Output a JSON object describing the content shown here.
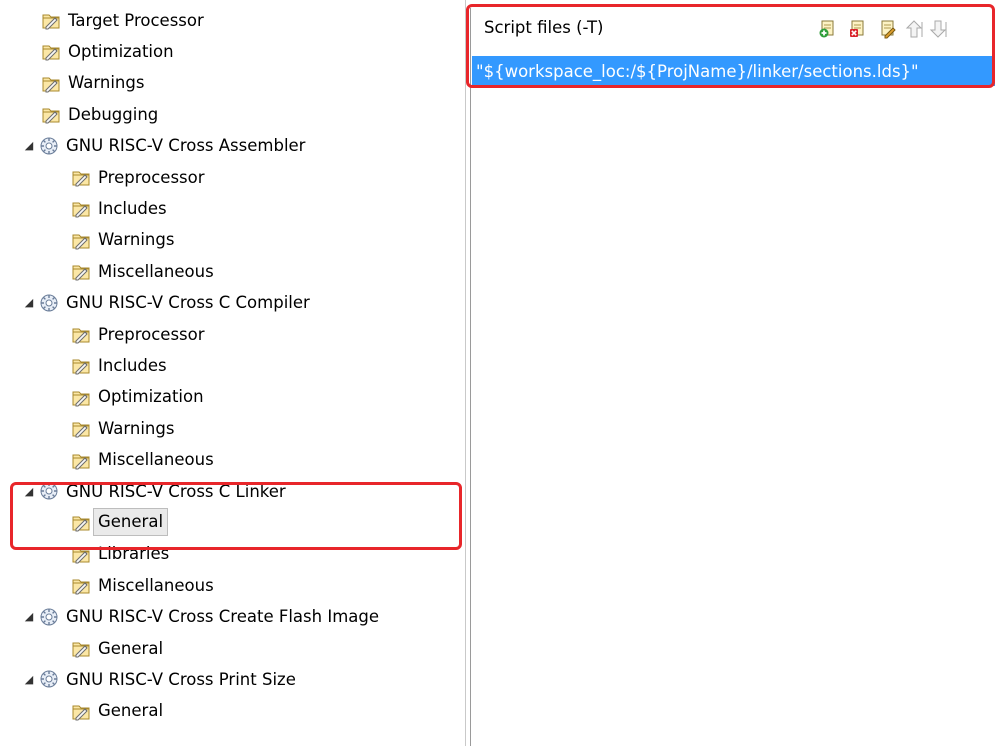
{
  "tree": {
    "items": [
      {
        "label": "Target Processor",
        "level": 1,
        "type": "option",
        "expanded": false,
        "selected": false
      },
      {
        "label": "Optimization",
        "level": 1,
        "type": "option",
        "expanded": false,
        "selected": false
      },
      {
        "label": "Warnings",
        "level": 1,
        "type": "option",
        "expanded": false,
        "selected": false
      },
      {
        "label": "Debugging",
        "level": 1,
        "type": "option",
        "expanded": false,
        "selected": false
      },
      {
        "label": "GNU RISC-V Cross Assembler",
        "level": 0,
        "type": "tool",
        "expanded": true,
        "selected": false
      },
      {
        "label": "Preprocessor",
        "level": 1,
        "type": "option",
        "expanded": false,
        "selected": false
      },
      {
        "label": "Includes",
        "level": 1,
        "type": "option",
        "expanded": false,
        "selected": false
      },
      {
        "label": "Warnings",
        "level": 1,
        "type": "option",
        "expanded": false,
        "selected": false
      },
      {
        "label": "Miscellaneous",
        "level": 1,
        "type": "option",
        "expanded": false,
        "selected": false
      },
      {
        "label": "GNU RISC-V Cross C Compiler",
        "level": 0,
        "type": "tool",
        "expanded": true,
        "selected": false
      },
      {
        "label": "Preprocessor",
        "level": 1,
        "type": "option",
        "expanded": false,
        "selected": false
      },
      {
        "label": "Includes",
        "level": 1,
        "type": "option",
        "expanded": false,
        "selected": false
      },
      {
        "label": "Optimization",
        "level": 1,
        "type": "option",
        "expanded": false,
        "selected": false
      },
      {
        "label": "Warnings",
        "level": 1,
        "type": "option",
        "expanded": false,
        "selected": false
      },
      {
        "label": "Miscellaneous",
        "level": 1,
        "type": "option",
        "expanded": false,
        "selected": false
      },
      {
        "label": "GNU RISC-V Cross C Linker",
        "level": 0,
        "type": "tool",
        "expanded": true,
        "selected": false
      },
      {
        "label": "General",
        "level": 1,
        "type": "option",
        "expanded": false,
        "selected": true
      },
      {
        "label": "Libraries",
        "level": 1,
        "type": "option",
        "expanded": false,
        "selected": false
      },
      {
        "label": "Miscellaneous",
        "level": 1,
        "type": "option",
        "expanded": false,
        "selected": false
      },
      {
        "label": "GNU RISC-V Cross Create Flash Image",
        "level": 0,
        "type": "tool",
        "expanded": true,
        "selected": false
      },
      {
        "label": "General",
        "level": 1,
        "type": "option",
        "expanded": false,
        "selected": false
      },
      {
        "label": "GNU RISC-V Cross Print Size",
        "level": 0,
        "type": "tool",
        "expanded": true,
        "selected": false
      },
      {
        "label": "General",
        "level": 1,
        "type": "option",
        "expanded": false,
        "selected": false
      }
    ]
  },
  "panel": {
    "title": "Script files (-T)",
    "toolbar": [
      "add-icon",
      "delete-icon",
      "edit-icon",
      "move-up-icon",
      "move-down-icon"
    ],
    "items": [
      "\"${workspace_loc:/${ProjName}/linker/sections.lds}\""
    ]
  },
  "colors": {
    "selection": "#3399ff",
    "highlight_box": "#e8262a"
  }
}
